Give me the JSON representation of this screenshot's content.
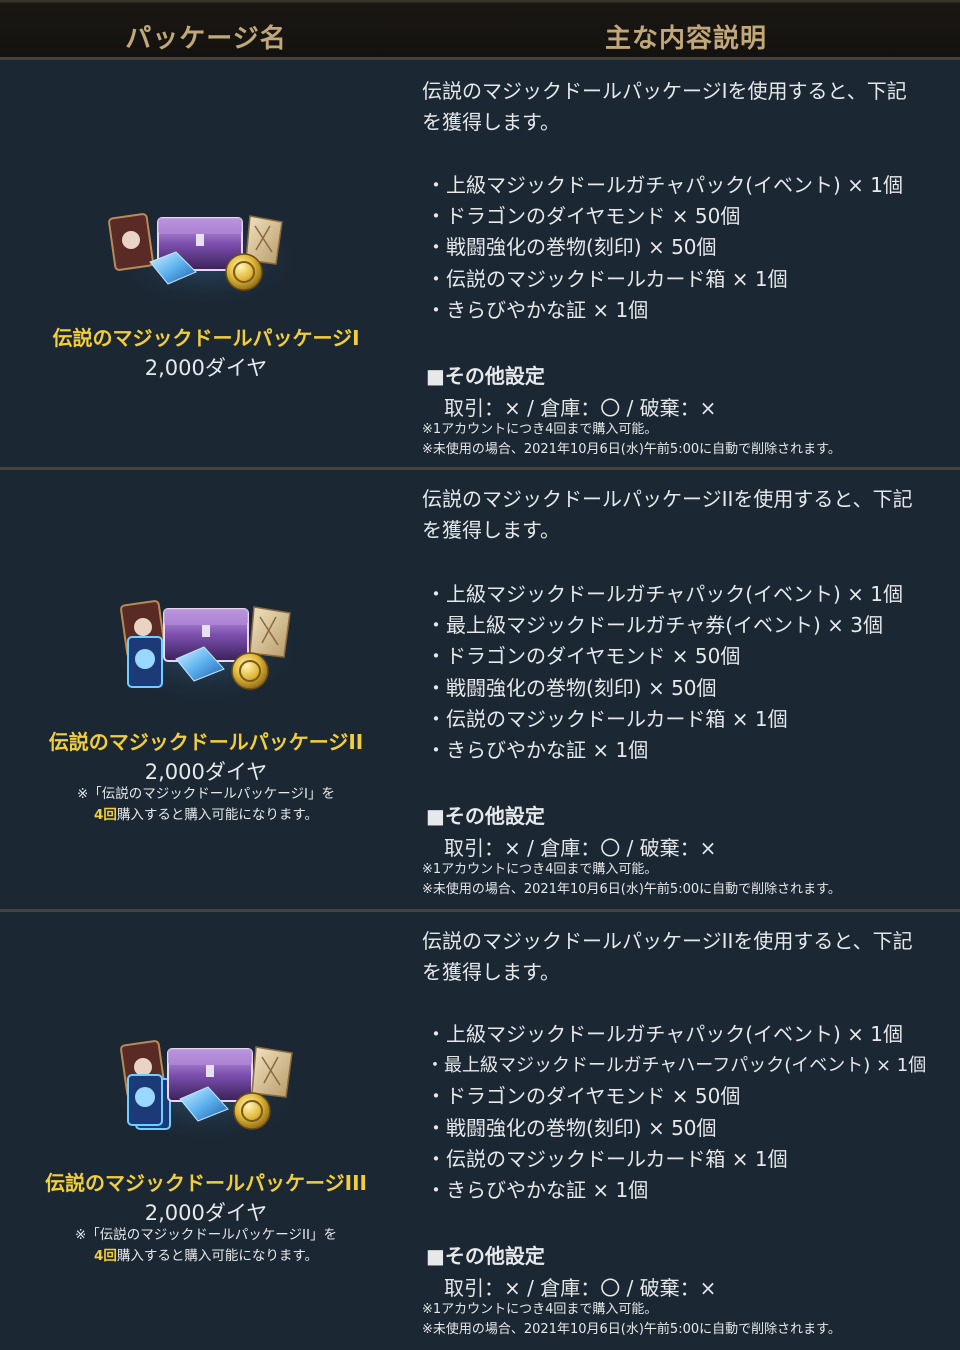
{
  "header": {
    "col1": "パッケージ名",
    "col2": "主な内容説明"
  },
  "packages": [
    {
      "name": "伝説のマジックドールパッケージI",
      "price": "2,000ダイヤ",
      "note_line1": "",
      "note_hl": "",
      "note_line2": "",
      "desc_line1": "伝説のマジックドールパッケージIを使用すると、下記",
      "desc_line2": "を獲得します。",
      "items": [
        "・上級マジックドールガチャパック(イベント) × 1個",
        "・ドラゴンのダイヤモンド × 50個",
        "・戦闘強化の巻物(刻印) × 50個",
        "・伝説のマジックドールカード箱 × 1個",
        "・きらびやかな証 × 1個"
      ],
      "settings_title": "■その他設定",
      "settings_line": "取引：× / 倉庫：〇 / 破棄：×",
      "fine1": "※1アカウントにつき4回まで購入可能。",
      "fine2": "※未使用の場合、2021年10月6日(水)午前5:00に自動で削除されます。"
    },
    {
      "name": "伝説のマジックドールパッケージII",
      "price": "2,000ダイヤ",
      "note_line1": "※「伝説のマジックドールパッケージI」を",
      "note_hl": "4回",
      "note_line2": "購入すると購入可能になります。",
      "desc_line1": "伝説のマジックドールパッケージIIを使用すると、下記",
      "desc_line2": "を獲得します。",
      "items": [
        "・上級マジックドールガチャパック(イベント) × 1個",
        "・最上級マジックドールガチャ券(イベント) × 3個",
        "・ドラゴンのダイヤモンド × 50個",
        "・戦闘強化の巻物(刻印) × 50個",
        "・伝説のマジックドールカード箱 × 1個",
        "・きらびやかな証 × 1個"
      ],
      "settings_title": "■その他設定",
      "settings_line": "取引：× / 倉庫：〇 / 破棄：×",
      "fine1": "※1アカウントにつき4回まで購入可能。",
      "fine2": "※未使用の場合、2021年10月6日(水)午前5:00に自動で削除されます。"
    },
    {
      "name": "伝説のマジックドールパッケージIII",
      "price": "2,000ダイヤ",
      "note_line1": "※「伝説のマジックドールパッケージII」を",
      "note_hl": "4回",
      "note_line2": "購入すると購入可能になります。",
      "desc_line1": "伝説のマジックドールパッケージIIを使用すると、下記",
      "desc_line2": "を獲得します。",
      "items": [
        "・上級マジックドールガチャパック(イベント) × 1個",
        "・最上級マジックドールガチャハーフパック(イベント) × 1個",
        "・ドラゴンのダイヤモンド × 50個",
        "・戦闘強化の巻物(刻印) × 50個",
        "・伝説のマジックドールカード箱 × 1個",
        "・きらびやかな証 × 1個"
      ],
      "settings_title": "■その他設定",
      "settings_line": "取引：× / 倉庫：〇 / 破棄：×",
      "fine1": "※1アカウントにつき4回まで購入可能。",
      "fine2": "※未使用の場合、2021年10月6日(水)午前5:00に自動で削除されます。"
    }
  ],
  "icons": [
    "package-bundle-icon",
    "package-bundle-icon",
    "package-bundle-icon"
  ],
  "colors": {
    "background": "#1b2733",
    "header_text": "#c2a878",
    "name_highlight": "#f2cf3a",
    "divider": "#4b4436"
  }
}
